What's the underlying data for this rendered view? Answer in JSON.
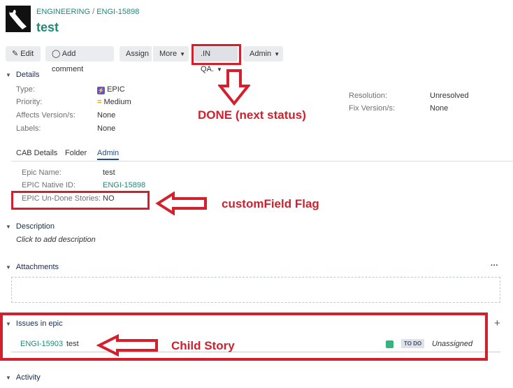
{
  "breadcrumb": {
    "project": "ENGINEERING",
    "separator": "/",
    "key": "ENGI-15898"
  },
  "title": "test",
  "toolbar": {
    "edit": "Edit",
    "comment": "Add comment",
    "assign": "Assign",
    "more": "More",
    "status": ".IN QA.",
    "admin": "Admin"
  },
  "details": {
    "header": "Details",
    "left": [
      {
        "label": "Type:",
        "value": "EPIC"
      },
      {
        "label": "Priority:",
        "value": "Medium"
      },
      {
        "label": "Affects Version/s:",
        "value": "None"
      },
      {
        "label": "Labels:",
        "value": "None"
      }
    ],
    "right": [
      {
        "label": "Resolution:",
        "value": "Unresolved"
      },
      {
        "label": "Fix Version/s:",
        "value": "None"
      }
    ]
  },
  "tabs": [
    "CAB Details",
    "Folder",
    "Admin"
  ],
  "admin_fields": [
    {
      "label": "Epic Name:",
      "value": "test"
    },
    {
      "label": "EPIC Native ID:",
      "value": "ENGI-15898"
    },
    {
      "label": "EPIC Un-Done Stories:",
      "value": "NO"
    }
  ],
  "description": {
    "header": "Description",
    "placeholder": "Click to add description"
  },
  "attachments": {
    "header": "Attachments",
    "more": "···"
  },
  "issues": {
    "header": "Issues in epic",
    "add": "+",
    "rows": [
      {
        "key": "ENGI-15903",
        "summary": "test",
        "status": "TO DO",
        "assignee": "Unassigned"
      }
    ]
  },
  "activity": {
    "header": "Activity"
  },
  "annotations": {
    "next_status": "DONE (next status)",
    "flag": "customField Flag",
    "child": "Child Story"
  },
  "colors": {
    "link": "#1f8a78",
    "annotation": "#d4202c",
    "epic": "#6554c0",
    "story": "#36b37e"
  }
}
